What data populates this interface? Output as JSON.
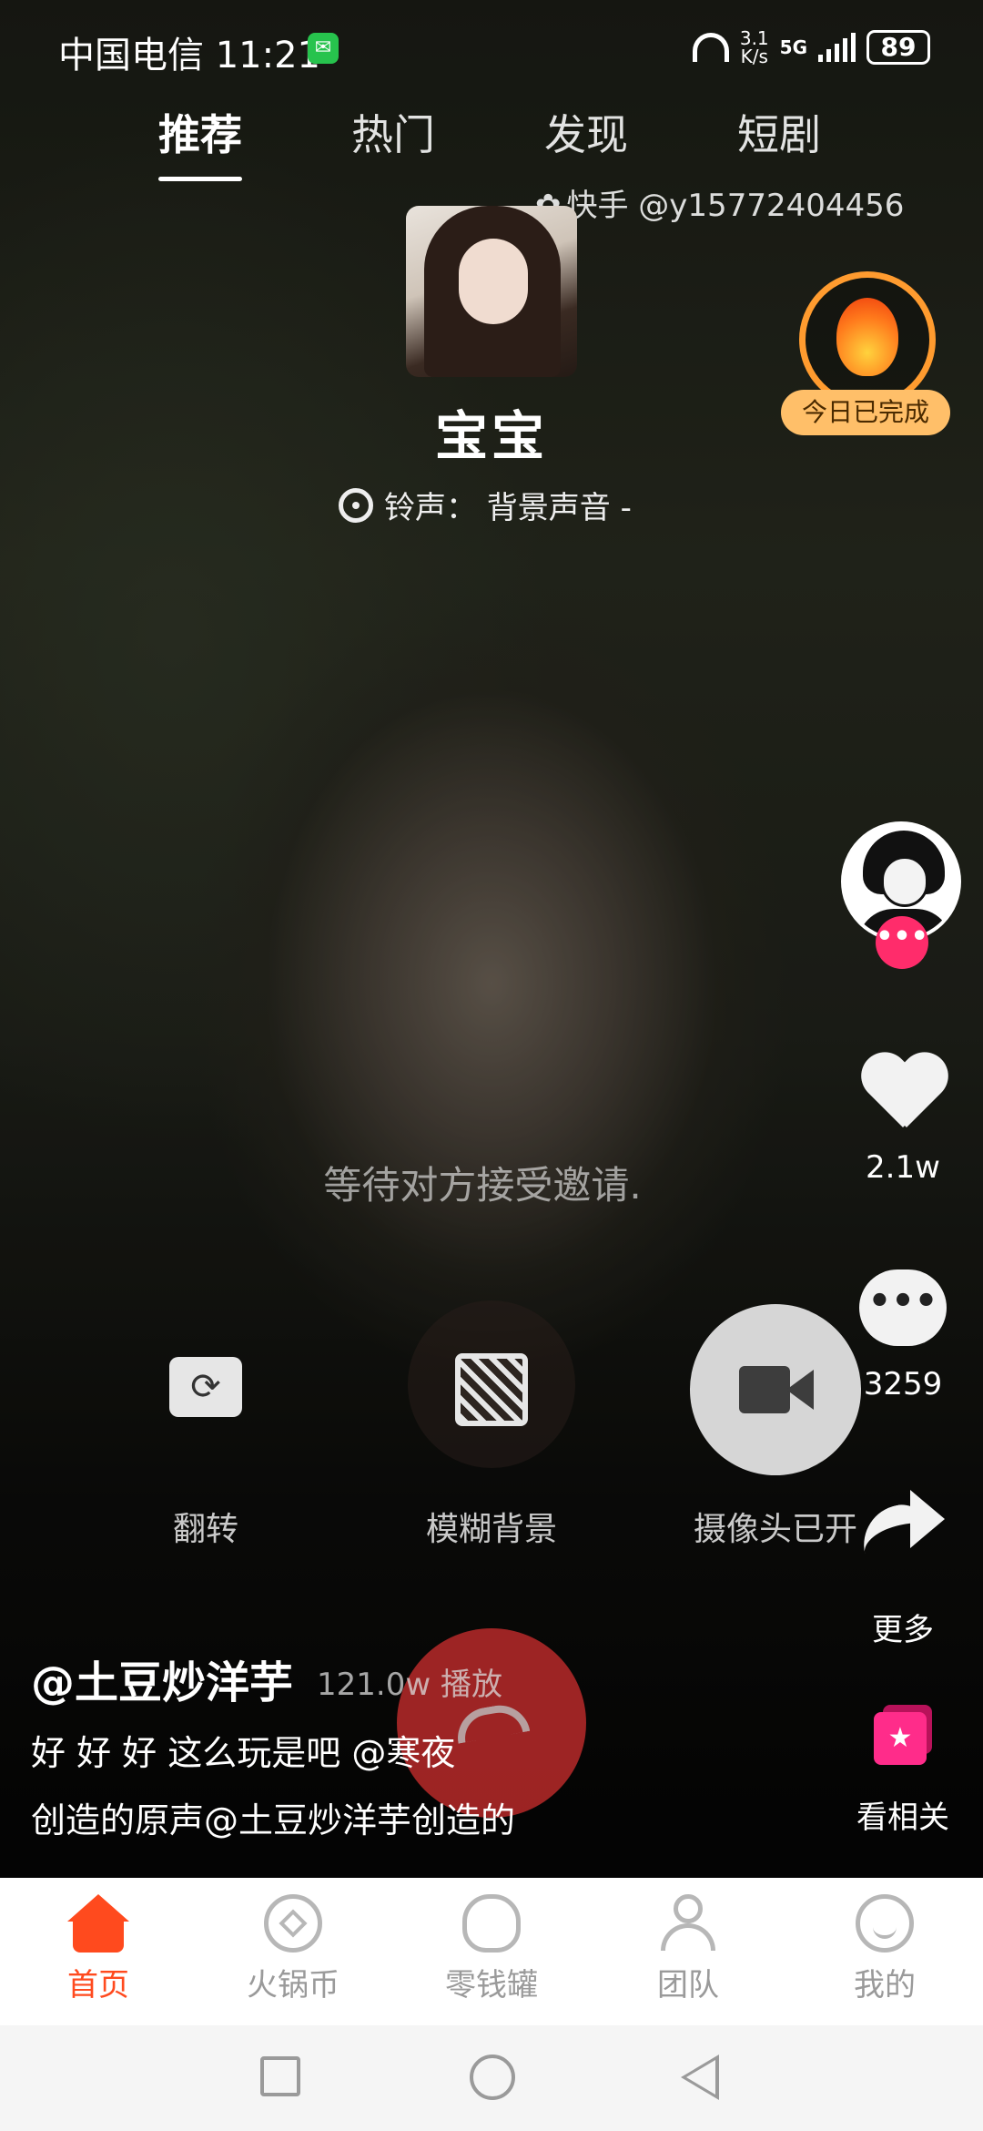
{
  "status_bar": {
    "carrier": "中国电信",
    "time": "11:21",
    "net_speed_value": "3.1",
    "net_speed_unit": "K/s",
    "network": "5G",
    "battery": "89"
  },
  "tabs": [
    {
      "label": "推荐",
      "active": true
    },
    {
      "label": "热门",
      "active": false
    },
    {
      "label": "发现",
      "active": false
    },
    {
      "label": "短剧",
      "active": false
    }
  ],
  "watermark": "快手 @y15772404456",
  "daily_task": {
    "badge": "今日已完成",
    "icon": "fire-icon"
  },
  "call": {
    "contact_name": "宝宝",
    "ringtone": "铃声： 背景声音 -",
    "waiting_text": "等待对方接受邀请.",
    "controls": {
      "flip": "翻转",
      "blur_background": "模糊背景",
      "camera_on": "摄像头已开"
    }
  },
  "right_rail": {
    "likes": "2.1w",
    "comments": "3259",
    "more": "更多",
    "related": "看相关"
  },
  "post": {
    "author": "@土豆炒洋芋",
    "plays": "121.0w 播放",
    "caption_line1": "好 好 好 这么玩是吧 @寒夜",
    "caption_line2": "创造的原声@土豆炒洋芋创造的"
  },
  "bottom_nav": [
    {
      "label": "首页",
      "icon": "home-icon",
      "active": true
    },
    {
      "label": "火锅币",
      "icon": "coin-icon",
      "active": false
    },
    {
      "label": "零钱罐",
      "icon": "piggy-bank-icon",
      "active": false
    },
    {
      "label": "团队",
      "icon": "team-icon",
      "active": false
    },
    {
      "label": "我的",
      "icon": "profile-icon",
      "active": false
    }
  ],
  "colors": {
    "accent": "#ff4a1e",
    "follow_pink": "#ff2c6b",
    "fire_ring": "#ff9b2f",
    "hangup_red": "#c82d2d"
  }
}
